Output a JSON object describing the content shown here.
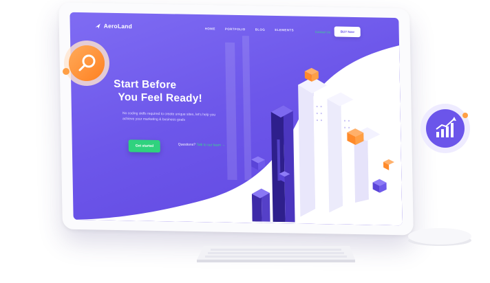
{
  "nav": {
    "brand": "AeroLand",
    "items": [
      "HOME",
      "PORTFOLIO",
      "BLOG",
      "ELEMENTS"
    ],
    "contact": "Contact Us",
    "buy_label": "BUY Now"
  },
  "hero": {
    "title_line1": "Start Before",
    "title_line2": "You Feel Ready!",
    "subtitle": "No coding skills required to create unique sites, let's help you achieve your marketing & business goals",
    "cta_label": "Get started",
    "question_text": "Questions?",
    "question_link": "Talk to our team →"
  },
  "icons": {
    "search": "search-icon",
    "growth": "growth-chart-icon",
    "logo": "aeroland-logo-icon"
  },
  "colors": {
    "primary": "#6d57ea",
    "accent_green": "#2fd27e",
    "accent_orange": "#ff8a2a",
    "wave_white": "#ffffff"
  }
}
